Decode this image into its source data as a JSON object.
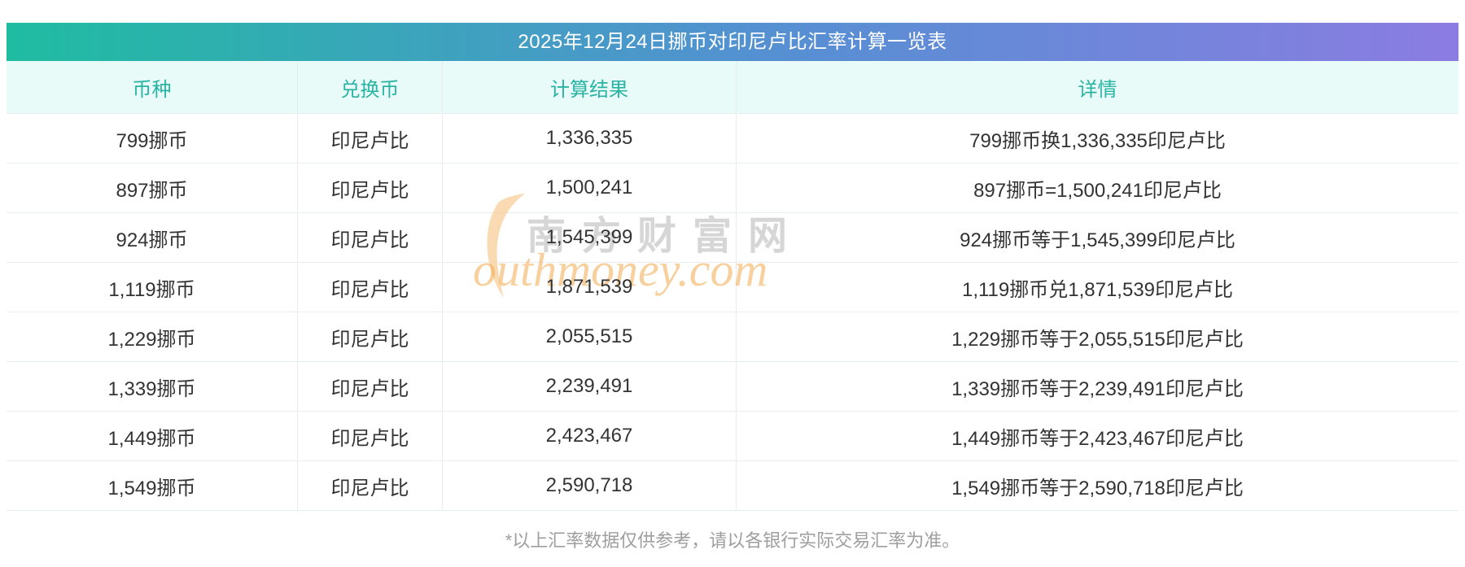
{
  "page": {
    "title": "2025年12月24日挪币对印尼卢比汇率计算一览表",
    "footnote": "*以上汇率数据仅供参考，请以各银行实际交易汇率为准。"
  },
  "table": {
    "columns": [
      "币种",
      "兑换币",
      "计算结果",
      "详情"
    ],
    "rows": [
      {
        "amount": "799挪币",
        "target": "印尼卢比",
        "result": "1,336,335",
        "detail": "799挪币换1,336,335印尼卢比"
      },
      {
        "amount": "897挪币",
        "target": "印尼卢比",
        "result": "1,500,241",
        "detail": "897挪币=1,500,241印尼卢比"
      },
      {
        "amount": "924挪币",
        "target": "印尼卢比",
        "result": "1,545,399",
        "detail": "924挪币等于1,545,399印尼卢比"
      },
      {
        "amount": "1,119挪币",
        "target": "印尼卢比",
        "result": "1,871,539",
        "detail": "1,119挪币兑1,871,539印尼卢比"
      },
      {
        "amount": "1,229挪币",
        "target": "印尼卢比",
        "result": "2,055,515",
        "detail": "1,229挪币等于2,055,515印尼卢比"
      },
      {
        "amount": "1,339挪币",
        "target": "印尼卢比",
        "result": "2,239,491",
        "detail": "1,339挪币等于2,239,491印尼卢比"
      },
      {
        "amount": "1,449挪币",
        "target": "印尼卢比",
        "result": "2,423,467",
        "detail": "1,449挪币等于2,423,467印尼卢比"
      },
      {
        "amount": "1,549挪币",
        "target": "印尼卢比",
        "result": "2,590,718",
        "detail": "1,549挪币等于2,590,718印尼卢比"
      }
    ]
  },
  "watermark": {
    "cn": "南方财富网",
    "en": "outhmoney.com"
  },
  "colors": {
    "gradient_start": "#1fbca1",
    "gradient_mid": "#5490d2",
    "gradient_end": "#8b7ce2",
    "header_bg": "#e9fbf8",
    "header_text": "#29b3a3",
    "body_text": "#333333",
    "border_row": "#e8eef3",
    "border_col": "#ebebeb",
    "footnote_text": "#9e9e9e",
    "watermark_gray": "#c9c9c9",
    "watermark_orange": "#f2ab4e",
    "watermark_swoosh": "#f8c98e"
  }
}
